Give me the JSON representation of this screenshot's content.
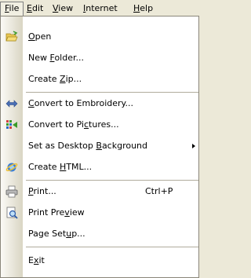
{
  "menubar": {
    "file": "File",
    "edit": "Edit",
    "view": "View",
    "internet": "Internet",
    "help": "Help"
  },
  "menu": {
    "open": "Open",
    "new_folder": "New Folder...",
    "create_zip": "Create Zip...",
    "convert_embroidery": "Convert to Embroidery...",
    "convert_pictures": "Convert to Pictures...",
    "set_desktop_background": "Set as Desktop Background",
    "create_html": "Create HTML...",
    "print": "Print...",
    "print_shortcut": "Ctrl+P",
    "print_preview": "Print Preview",
    "page_setup": "Page Setup...",
    "exit": "Exit"
  },
  "icons": {
    "open": "folder-open-icon",
    "convert_embroidery": "double-arrow-icon",
    "convert_pictures": "convert-pictures-icon",
    "create_html": "internet-explorer-icon",
    "print": "printer-icon",
    "print_preview": "print-preview-icon"
  }
}
